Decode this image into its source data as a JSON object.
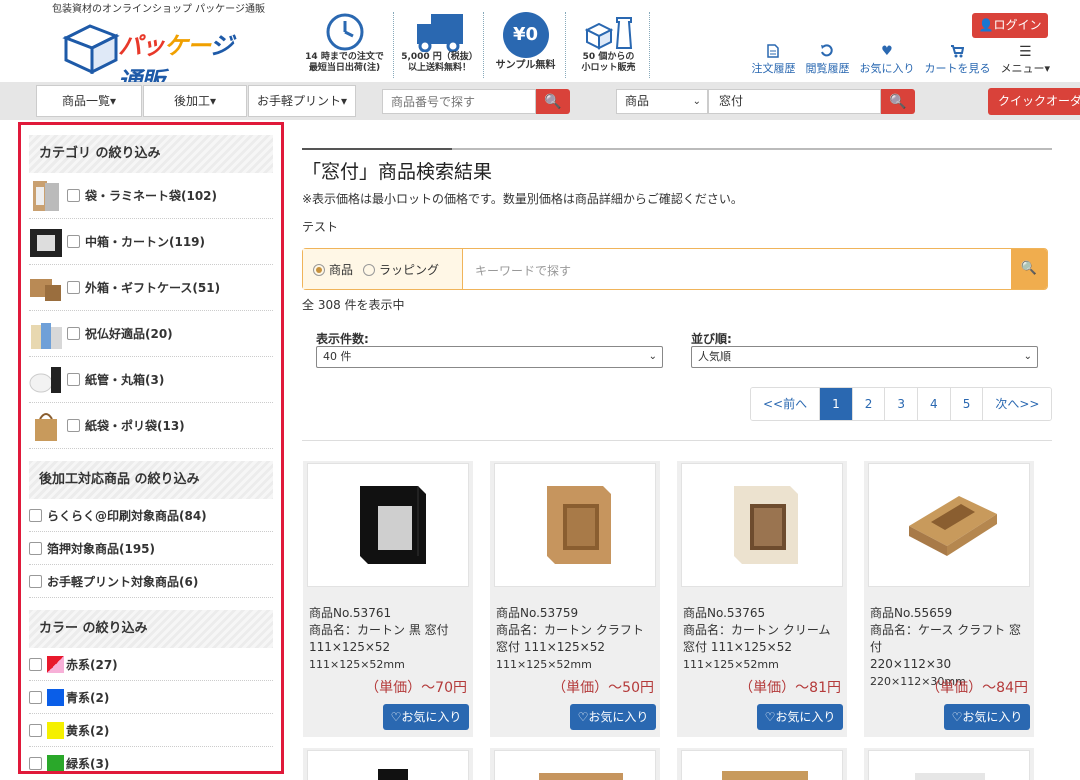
{
  "header": {
    "tagline": "包装資材のオンラインショップ パッケージ通販",
    "logo": {
      "part1": "パッ",
      "part2": "ケー",
      "part3": "ジ通販"
    },
    "features": [
      {
        "icon": "clock-icon",
        "line1": "14 時までの注文で",
        "line2": "最短当日出荷(注)"
      },
      {
        "icon": "truck-icon",
        "line1": "5,000 円（税抜）",
        "line2": "以上送料無料！"
      },
      {
        "icon": "sample-icon",
        "badge": "¥0",
        "line1": "サンプル無料",
        "line2": ""
      },
      {
        "icon": "boxes-icon",
        "line1": "50 個からの",
        "line2": "小ロット販売"
      }
    ],
    "login": "ログイン",
    "links": [
      {
        "icon": "document-icon",
        "label": "注文履歴"
      },
      {
        "icon": "history-icon",
        "label": "閲覧履歴"
      },
      {
        "icon": "heart-icon",
        "label": "お気に入り"
      },
      {
        "icon": "cart-icon",
        "label": "カートを見る"
      },
      {
        "icon": "menu-icon",
        "label": "メニュー▾"
      }
    ]
  },
  "nav": {
    "buttons": [
      "商品一覧▾",
      "後加工▾",
      "お手軽プリント▾"
    ],
    "product_search_placeholder": "商品番号で探す",
    "scope_select": "商品",
    "keyword_value": "窓付",
    "quick_order": "クイックオーダー"
  },
  "sidebar": {
    "category_heading": "カテゴリ の絞り込み",
    "categories": [
      {
        "label": "袋・ラミネート袋(102)"
      },
      {
        "label": "中箱・カートン(119)"
      },
      {
        "label": "外箱・ギフトケース(51)"
      },
      {
        "label": "祝仏好適品(20)"
      },
      {
        "label": "紙管・丸箱(3)"
      },
      {
        "label": "紙袋・ポリ袋(13)"
      }
    ],
    "process_heading": "後加工対応商品 の絞り込み",
    "processes": [
      {
        "label": "らくらく@印刷対象商品(84)"
      },
      {
        "label": "箔押対象商品(195)"
      },
      {
        "label": "お手軽プリント対象商品(6)"
      }
    ],
    "color_heading": "カラー の絞り込み",
    "colors": [
      {
        "label": "赤系(27)",
        "color": "#e8192c"
      },
      {
        "label": "青系(2)",
        "color": "#0a5ee8"
      },
      {
        "label": "黄系(2)",
        "color": "#f5f000"
      },
      {
        "label": "緑系(3)",
        "color": "#2aa82a"
      }
    ]
  },
  "main": {
    "title": "「窓付」商品検索結果",
    "note": "※表示価格は最小ロットの価格です。数量別価格は商品詳細からご確認ください。",
    "test": "テスト",
    "radio_product": "商品",
    "radio_wrapping": "ラッピング",
    "keyword_placeholder": "キーワードで探す",
    "result_count": "全 308 件を表示中",
    "per_page_label": "表示件数:",
    "per_page_value": "40 件",
    "sort_label": "並び順:",
    "sort_value": "人気順",
    "pager": [
      "<<前へ",
      "1",
      "2",
      "3",
      "4",
      "5",
      "次へ>>"
    ],
    "products": [
      {
        "no": "商品No.53761",
        "name": "商品名：カートン 黒 窓付",
        "size": "111×125×52",
        "dims": "111×125×52mm",
        "price": "（単価）～70円",
        "fav": "♡お気に入り",
        "box_color": "#111111"
      },
      {
        "no": "商品No.53759",
        "name": "商品名：カートン クラフト 窓付 111×125×52",
        "size": "",
        "dims": "111×125×52mm",
        "price": "（単価）～50円",
        "fav": "♡お気に入り",
        "box_color": "#c6955e"
      },
      {
        "no": "商品No.53765",
        "name": "商品名：カートン クリーム 窓付 111×125×52",
        "size": "",
        "dims": "111×125×52mm",
        "price": "（単価）～81円",
        "fav": "♡お気に入り",
        "box_color": "#ece2cf"
      },
      {
        "no": "商品No.55659",
        "name": "商品名：ケース クラフト 窓付",
        "size": "220×112×30",
        "dims": "220×112×30mm",
        "price": "（単価）～84円",
        "fav": "♡お気に入り",
        "box_color": "#c89a5c"
      }
    ]
  }
}
